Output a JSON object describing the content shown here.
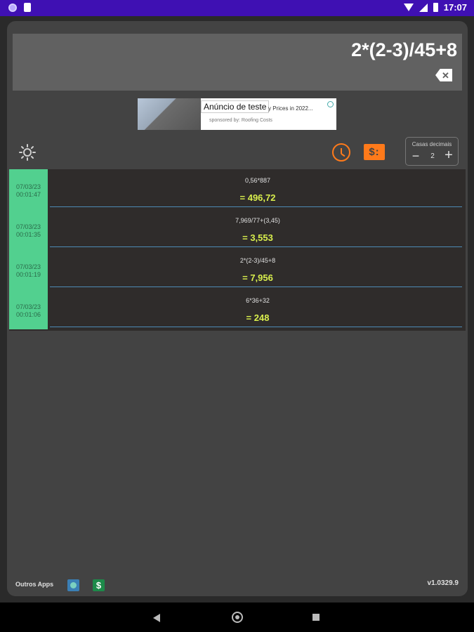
{
  "status_bar": {
    "time": "17:07"
  },
  "display": {
    "expression": "2*(2-3)/45+8"
  },
  "ad": {
    "label": "Anúncio de teste",
    "headline": "y Prices in 2022...",
    "sponsor": "sponsored by: Roofing Costs"
  },
  "toolbar": {
    "currency_label": "$:",
    "decimals": {
      "title": "Casas decimais",
      "value": "2",
      "minus": "−",
      "plus": "+"
    }
  },
  "history": [
    {
      "date": "07/03/23",
      "time": "00:01:47",
      "expression": "0,56*887",
      "result": "= 496,72"
    },
    {
      "date": "07/03/23",
      "time": "00:01:35",
      "expression": "7,969/77+(3,45)",
      "result": "= 3,553"
    },
    {
      "date": "07/03/23",
      "time": "00:01:19",
      "expression": "2*(2-3)/45+8",
      "result": "= 7,956"
    },
    {
      "date": "07/03/23",
      "time": "00:01:06",
      "expression": "6*36+32",
      "result": "= 248"
    }
  ],
  "footer": {
    "other_apps": "Outros Apps",
    "app2_glyph": "$",
    "version": "v1.0329.9"
  },
  "colors": {
    "accent": "#ff7a1a",
    "result": "#d9ef4d",
    "date_bg": "#52d08f",
    "status_bar": "#3f10b3"
  }
}
